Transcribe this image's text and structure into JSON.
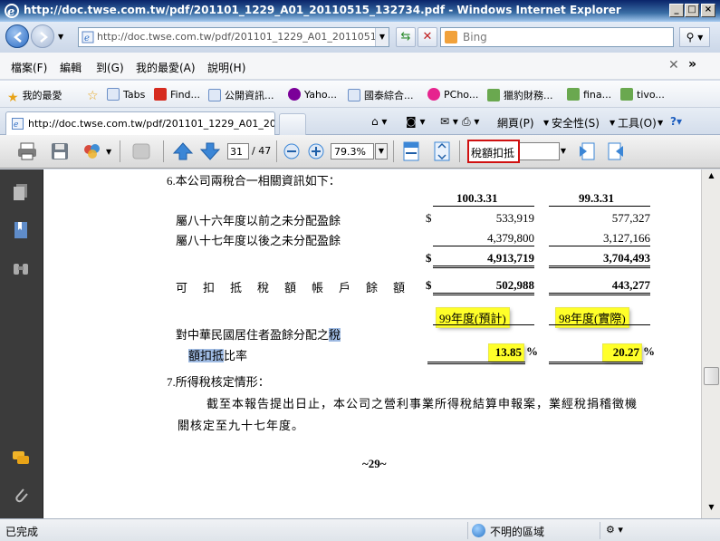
{
  "window": {
    "title": "http://doc.twse.com.tw/pdf/201101_1229_A01_20110515_132734.pdf - Windows Internet Explorer"
  },
  "address": {
    "url": "http://doc.twse.com.tw/pdf/201101_1229_A01_20110515_13273"
  },
  "search": {
    "placeholder": "Bing"
  },
  "menu": {
    "items": [
      "檔案(F)",
      "編輯",
      "到(G)",
      "我的最愛(A)",
      "說明(H)"
    ]
  },
  "favorites": {
    "label": "我的最愛",
    "items": [
      "Tabs",
      "Find...",
      "公開資訊...",
      "Yaho...",
      "國泰綜合...",
      "PCho...",
      "獵豹財務...",
      "fina...",
      "tivo..."
    ]
  },
  "tab": {
    "title": "http://doc.twse.com.tw/pdf/201101_1229_A01_201105..."
  },
  "commands": {
    "page": "網頁(P)",
    "safety": "安全性(S)",
    "tools": "工具(O)"
  },
  "pdf_toolbar": {
    "page_current": "31",
    "page_total": "/ 47",
    "zoom": "79.3%",
    "find_text": "稅額扣抵"
  },
  "document": {
    "heading6": "6.本公司兩稅合一相關資訊如下：",
    "col1_header": "100.3.31",
    "col2_header": "99.3.31",
    "rows": [
      {
        "label": "屬八十六年度以前之未分配盈餘",
        "cur": "$",
        "v1": "533,919",
        "v2": "577,327"
      },
      {
        "label": "屬八十七年度以後之未分配盈餘",
        "cur": "",
        "v1": "4,379,800",
        "v2": "3,127,166"
      },
      {
        "label": "",
        "cur": "$",
        "v1": "4,913,719",
        "v2": "3,704,493"
      },
      {
        "label": "可　扣　抵　稅　額　帳　戶　餘　額",
        "cur": "$",
        "v1": "502,988",
        "v2": "443,277"
      }
    ],
    "year1_label": "99年度(預計)",
    "year2_label": "98年度(實際)",
    "ratio_label_line1": "對中華民國居住者盈餘分配之",
    "ratio_label_sel1": "稅",
    "ratio_label_sel2": "額扣抵",
    "ratio_label_line2": "比率",
    "ratio1": "13.85",
    "ratio2": "20.27",
    "pct": "%",
    "heading7": "7.所得稅核定情形：",
    "para7_line1": "截至本報告提出日止，本公司之營利事業所得稅結算申報案，業經稅捐稽徵機",
    "para7_line2": "關核定至九十七年度。",
    "page_number": "~29~"
  },
  "status": {
    "text": "已完成",
    "zone": "不明的區域"
  },
  "colors": {
    "highlight": "#ffff29",
    "selection": "#9fbbe3",
    "find_border": "#d01010"
  }
}
